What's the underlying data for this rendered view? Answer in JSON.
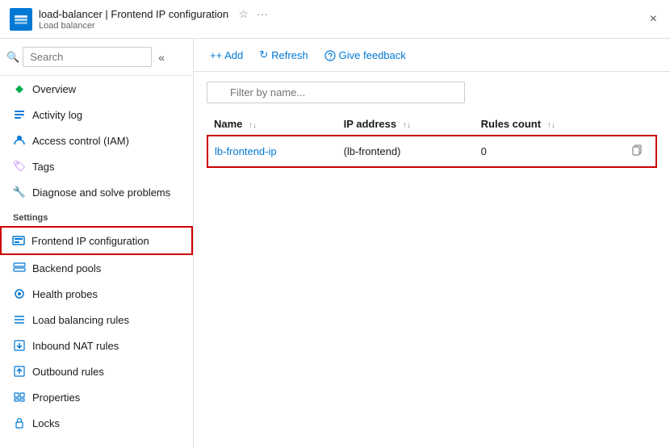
{
  "titleBar": {
    "resourceName": "load-balancer",
    "separator": " | ",
    "pageName": "Frontend IP configuration",
    "resourceType": "Load balancer",
    "closeBtn": "×"
  },
  "toolbar": {
    "addLabel": "+ Add",
    "refreshLabel": "Refresh",
    "feedbackLabel": "Give feedback"
  },
  "filter": {
    "placeholder": "Filter by name..."
  },
  "table": {
    "columns": [
      {
        "label": "Name",
        "sort": "↑↓"
      },
      {
        "label": "IP address",
        "sort": "↑↓"
      },
      {
        "label": "Rules count",
        "sort": "↑↓"
      }
    ],
    "rows": [
      {
        "name": "lb-frontend-ip",
        "ipAddress": "(lb-frontend)",
        "rulesCount": "0"
      }
    ]
  },
  "sidebar": {
    "searchPlaceholder": "Search",
    "navItems": [
      {
        "id": "overview",
        "label": "Overview",
        "iconType": "diamond",
        "active": false
      },
      {
        "id": "activity-log",
        "label": "Activity log",
        "iconType": "list",
        "active": false
      },
      {
        "id": "access-control",
        "label": "Access control (IAM)",
        "iconType": "person",
        "active": false
      },
      {
        "id": "tags",
        "label": "Tags",
        "iconType": "tag",
        "active": false
      },
      {
        "id": "diagnose",
        "label": "Diagnose and solve problems",
        "iconType": "wrench",
        "active": false
      }
    ],
    "settingsLabel": "Settings",
    "settingsItems": [
      {
        "id": "frontend-ip",
        "label": "Frontend IP configuration",
        "iconType": "frontend",
        "active": true
      },
      {
        "id": "backend-pools",
        "label": "Backend pools",
        "iconType": "backend",
        "active": false
      },
      {
        "id": "health-probes",
        "label": "Health probes",
        "iconType": "probe",
        "active": false
      },
      {
        "id": "load-balancing-rules",
        "label": "Load balancing rules",
        "iconType": "rules",
        "active": false
      },
      {
        "id": "inbound-nat",
        "label": "Inbound NAT rules",
        "iconType": "inbound",
        "active": false
      },
      {
        "id": "outbound-rules",
        "label": "Outbound rules",
        "iconType": "outbound",
        "active": false
      },
      {
        "id": "properties",
        "label": "Properties",
        "iconType": "properties",
        "active": false
      },
      {
        "id": "locks",
        "label": "Locks",
        "iconType": "lock",
        "active": false
      }
    ]
  }
}
